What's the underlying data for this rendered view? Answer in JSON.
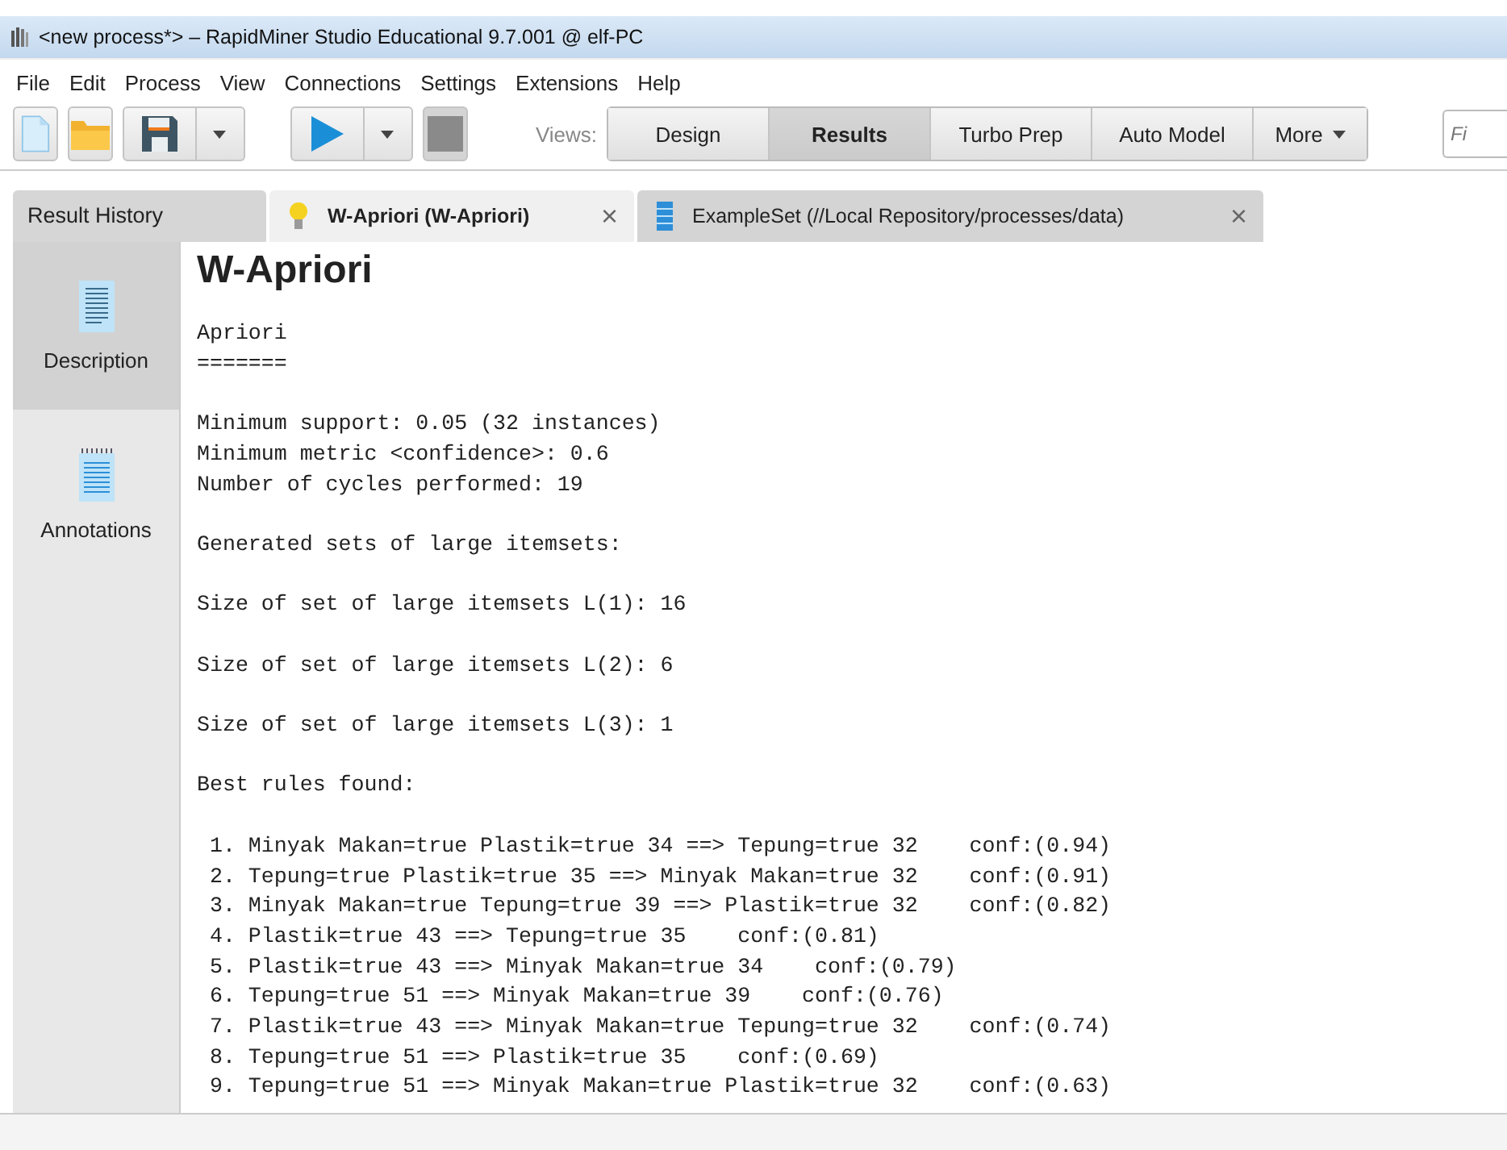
{
  "window": {
    "title": "<new process*> – RapidMiner Studio Educational 9.7.001 @ elf-PC"
  },
  "menu": [
    "File",
    "Edit",
    "Process",
    "View",
    "Connections",
    "Settings",
    "Extensions",
    "Help"
  ],
  "toolbar": {
    "views_label": "Views:",
    "views": [
      {
        "label": "Design",
        "selected": false
      },
      {
        "label": "Results",
        "selected": true
      },
      {
        "label": "Turbo Prep",
        "selected": false
      },
      {
        "label": "Auto Model",
        "selected": false
      },
      {
        "label": "More",
        "selected": false
      }
    ],
    "search": {
      "placeholder": "Fi"
    }
  },
  "result_history": "Result History",
  "tabs": [
    {
      "label": "W-Apriori (W-Apriori)",
      "kind": "model",
      "selected": true,
      "close": "×"
    },
    {
      "label": "ExampleSet (//Local Repository/processes/data)",
      "kind": "table",
      "selected": false,
      "close": "×"
    }
  ],
  "sidebar": [
    {
      "label": "Description",
      "kind": "description",
      "selected": true
    },
    {
      "label": "Annotations",
      "kind": "annotations",
      "selected": false
    }
  ],
  "content": {
    "title": "W-Apriori",
    "blocks": [
      [
        "Apriori",
        "======="
      ],
      [
        "Minimum support: 0.05 (32 instances)",
        "Minimum metric <confidence>: 0.6",
        "Number of cycles performed: 19"
      ],
      [
        "Generated sets of large itemsets:"
      ],
      [
        "Size of set of large itemsets L(1): 16"
      ],
      [
        "Size of set of large itemsets L(2): 6"
      ],
      [
        "Size of set of large itemsets L(3): 1"
      ],
      [
        "Best rules found:"
      ],
      [
        " 1. Minyak Makan=true Plastik=true 34 ==> Tepung=true 32    conf:(0.94)",
        " 2. Tepung=true Plastik=true 35 ==> Minyak Makan=true 32    conf:(0.91)",
        " 3. Minyak Makan=true Tepung=true 39 ==> Plastik=true 32    conf:(0.82)",
        " 4. Plastik=true 43 ==> Tepung=true 35    conf:(0.81)",
        " 5. Plastik=true 43 ==> Minyak Makan=true 34    conf:(0.79)",
        " 6. Tepung=true 51 ==> Minyak Makan=true 39    conf:(0.76)",
        " 7. Plastik=true 43 ==> Minyak Makan=true Tepung=true 32    conf:(0.74)",
        " 8. Tepung=true 51 ==> Plastik=true 35    conf:(0.69)",
        " 9. Tepung=true 51 ==> Minyak Makan=true Plastik=true 32    conf:(0.63)"
      ]
    ]
  }
}
